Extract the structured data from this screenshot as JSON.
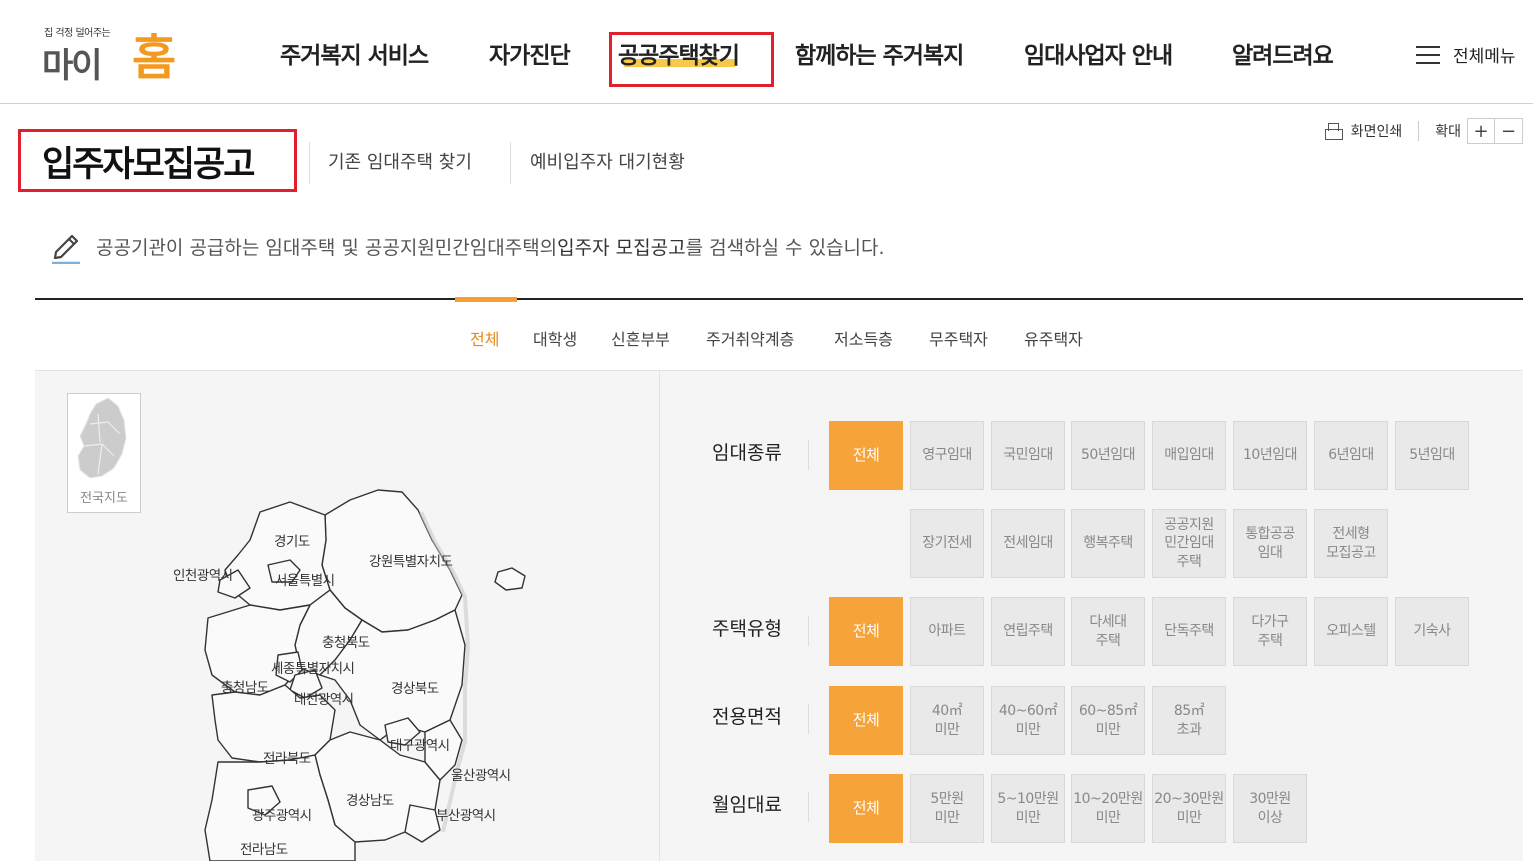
{
  "header": {
    "logo_tag": "집 걱정 덜어주는",
    "logo_main": "마이",
    "logo_home": "홈",
    "nav": [
      "주거복지 서비스",
      "자가진단",
      "공공주택찾기",
      "함께하는 주거복지",
      "임대사업자 안내",
      "알려드려요"
    ],
    "nav_active": "공공주택찾기",
    "all_menu": "전체메뉴"
  },
  "page": {
    "title": "입주자모집공고",
    "subnav": [
      "기존 임대주택 찾기",
      "예비입주자 대기현황"
    ],
    "print": "화면인쇄",
    "zoom": "확대",
    "zoom_in": "+",
    "zoom_out": "−",
    "description_pre": "공공기관이 공급하는 임대주택 및 공공지원민간임대주택의 ",
    "description_strong": "입주자 모집공고",
    "description_post": "를 검색하실 수 있습니다."
  },
  "tabs": [
    "전체",
    "대학생",
    "신혼부부",
    "주거취약계층",
    "저소득층",
    "무주택자",
    "유주택자"
  ],
  "active_tab": "전체",
  "map": {
    "nationwide": "전국지도",
    "regions": [
      "경기도",
      "인천광역시",
      "서울특별시",
      "강원특별자치도",
      "충청북도",
      "세종특별자치시",
      "충청남도",
      "대전광역시",
      "경상북도",
      "대구광역시",
      "전라북도",
      "울산광역시",
      "경상남도",
      "광주광역시",
      "부산광역시",
      "전라남도"
    ]
  },
  "filters": {
    "rent_type": {
      "label": "임대종류",
      "row1": [
        "전체",
        "영구임대",
        "국민임대",
        "50년임대",
        "매입임대",
        "10년임대",
        "6년임대",
        "5년임대"
      ],
      "row2": [
        "장기전세",
        "전세임대",
        "행복주택",
        "공공지원\n민간임대\n주택",
        "통합공공\n임대",
        "전세형\n모집공고"
      ]
    },
    "house_type": {
      "label": "주택유형",
      "options": [
        "전체",
        "아파트",
        "연립주택",
        "다세대\n주택",
        "단독주택",
        "다가구\n주택",
        "오피스텔",
        "기숙사"
      ]
    },
    "area": {
      "label": "전용면적",
      "options": [
        "전체",
        "40㎡\n미만",
        "40~60㎡\n미만",
        "60~85㎡\n미만",
        "85㎡\n초과"
      ]
    },
    "monthly_rent": {
      "label": "월임대료",
      "options": [
        "전체",
        "5만원\n미만",
        "5~10만원\n미만",
        "10~20만원\n미만",
        "20~30만원\n미만",
        "30만원\n이상"
      ]
    }
  },
  "colors": {
    "accent": "#f6a33a",
    "highlight_box": "#e0202c",
    "nav_highlight": "#f7c948"
  }
}
